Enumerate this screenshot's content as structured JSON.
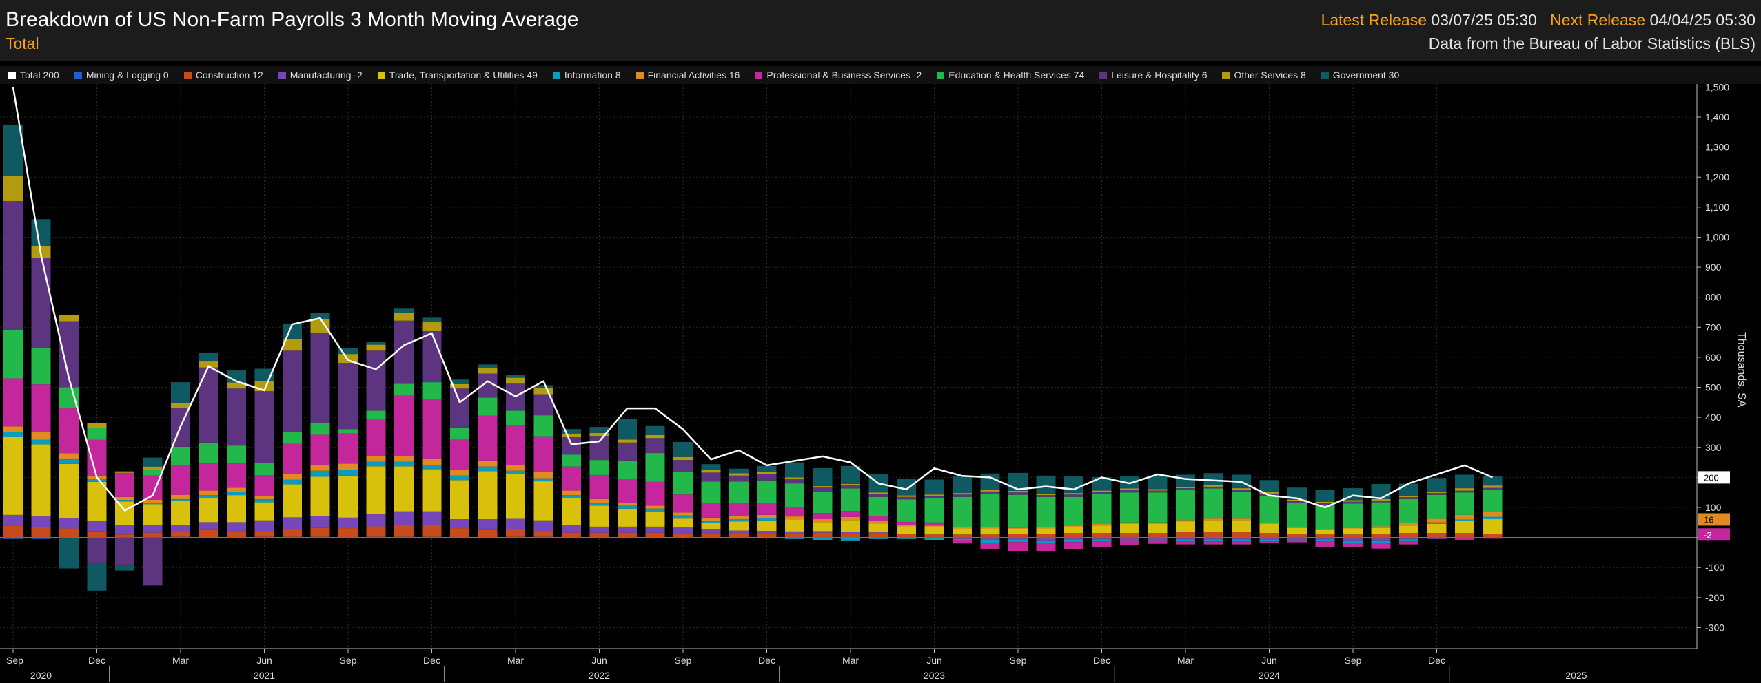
{
  "header": {
    "title": "Breakdown of US Non-Farm Payrolls 3 Month Moving Average",
    "subtitle": "Total",
    "latest_label": "Latest Release",
    "latest_value": "03/07/25 05:30",
    "next_label": "Next Release",
    "next_value": "04/04/25 05:30",
    "source": "Data from the Bureau of Labor Statistics (BLS)"
  },
  "chart_data": {
    "type": "bar",
    "title": "Breakdown of US Non-Farm Payrolls 3 Month Moving Average",
    "ylabel": "Thousands, SA",
    "ylim": [
      -370,
      1510
    ],
    "y_ticks": [
      -300,
      -200,
      -100,
      0,
      100,
      200,
      300,
      400,
      500,
      600,
      700,
      800,
      900,
      1000,
      1100,
      1200,
      1300,
      1400,
      1500
    ],
    "grid": true,
    "legend_placement": "top",
    "x_ticks": [
      {
        "i": 0,
        "label": "Sep"
      },
      {
        "i": 3,
        "label": "Dec"
      },
      {
        "i": 6,
        "label": "Mar"
      },
      {
        "i": 9,
        "label": "Jun"
      },
      {
        "i": 12,
        "label": "Sep"
      },
      {
        "i": 15,
        "label": "Dec"
      },
      {
        "i": 18,
        "label": "Mar"
      },
      {
        "i": 21,
        "label": "Jun"
      },
      {
        "i": 24,
        "label": "Sep"
      },
      {
        "i": 27,
        "label": "Dec"
      },
      {
        "i": 30,
        "label": "Mar"
      },
      {
        "i": 33,
        "label": "Jun"
      },
      {
        "i": 36,
        "label": "Sep"
      },
      {
        "i": 39,
        "label": "Dec"
      },
      {
        "i": 42,
        "label": "Mar"
      },
      {
        "i": 45,
        "label": "Jun"
      },
      {
        "i": 48,
        "label": "Sep"
      },
      {
        "i": 51,
        "label": "Dec"
      }
    ],
    "year_labels": [
      {
        "i": 1.0,
        "label": "2020"
      },
      {
        "i": 9.0,
        "label": "2021"
      },
      {
        "i": 21.0,
        "label": "2022"
      },
      {
        "i": 33.0,
        "label": "2023"
      },
      {
        "i": 45.0,
        "label": "2024"
      },
      {
        "i": 56.0,
        "label": "2025"
      }
    ],
    "year_boundaries": [
      4,
      16,
      28,
      40,
      52
    ],
    "categories": [
      "Sep 2020",
      "Oct 2020",
      "Nov 2020",
      "Dec 2020",
      "Jan 2021",
      "Feb 2021",
      "Mar 2021",
      "Apr 2021",
      "May 2021",
      "Jun 2021",
      "Jul 2021",
      "Aug 2021",
      "Sep 2021",
      "Oct 2021",
      "Nov 2021",
      "Dec 2021",
      "Jan 2022",
      "Feb 2022",
      "Mar 2022",
      "Apr 2022",
      "May 2022",
      "Jun 2022",
      "Jul 2022",
      "Aug 2022",
      "Sep 2022",
      "Oct 2022",
      "Nov 2022",
      "Dec 2022",
      "Jan 2023",
      "Feb 2023",
      "Mar 2023",
      "Apr 2023",
      "May 2023",
      "Jun 2023",
      "Jul 2023",
      "Aug 2023",
      "Sep 2023",
      "Oct 2023",
      "Nov 2023",
      "Dec 2023",
      "Jan 2024",
      "Feb 2024",
      "Mar 2024",
      "Apr 2024",
      "May 2024",
      "Jun 2024",
      "Jul 2024",
      "Aug 2024",
      "Sep 2024",
      "Oct 2024",
      "Nov 2024",
      "Dec 2024",
      "Jan 2025",
      "Feb 2025"
    ],
    "series": [
      {
        "name": "Total",
        "latest": 200,
        "color": "#ffffff",
        "type": "line",
        "values": [
          1500,
          940,
          530,
          200,
          90,
          140,
          370,
          570,
          520,
          490,
          710,
          730,
          590,
          560,
          640,
          680,
          450,
          520,
          470,
          520,
          310,
          320,
          430,
          430,
          360,
          260,
          290,
          240,
          255,
          270,
          250,
          180,
          160,
          230,
          205,
          200,
          160,
          170,
          160,
          200,
          180,
          210,
          195,
          190,
          185,
          140,
          130,
          100,
          140,
          130,
          180,
          210,
          240,
          200
        ]
      },
      {
        "name": "Mining & Logging",
        "latest": 0,
        "color": "#1f5fd0",
        "values": [
          -5,
          -5,
          -3,
          -2,
          0,
          1,
          2,
          1,
          1,
          2,
          2,
          2,
          1,
          2,
          2,
          2,
          1,
          1,
          2,
          2,
          1,
          1,
          1,
          1,
          1,
          1,
          1,
          0,
          0,
          1,
          0,
          0,
          0,
          0,
          0,
          0,
          0,
          0,
          0,
          0,
          0,
          0,
          0,
          0,
          0,
          0,
          0,
          0,
          0,
          0,
          0,
          0,
          0,
          0
        ]
      },
      {
        "name": "Construction",
        "latest": 12,
        "color": "#c84b1c",
        "values": [
          40,
          35,
          30,
          20,
          10,
          15,
          20,
          25,
          20,
          20,
          25,
          30,
          30,
          35,
          40,
          40,
          30,
          25,
          25,
          20,
          15,
          15,
          15,
          15,
          12,
          12,
          10,
          12,
          15,
          15,
          15,
          15,
          12,
          10,
          10,
          10,
          12,
          12,
          15,
          15,
          15,
          15,
          18,
          18,
          18,
          15,
          12,
          10,
          10,
          12,
          15,
          15,
          15,
          12
        ]
      },
      {
        "name": "Manufacturing",
        "latest": -2,
        "color": "#7547b8",
        "values": [
          35,
          35,
          35,
          35,
          30,
          25,
          20,
          25,
          30,
          35,
          40,
          40,
          35,
          40,
          45,
          45,
          30,
          35,
          35,
          35,
          25,
          20,
          20,
          20,
          20,
          15,
          12,
          10,
          5,
          5,
          3,
          2,
          0,
          -3,
          -5,
          -8,
          -10,
          -12,
          -10,
          -8,
          -8,
          -8,
          -10,
          -10,
          -10,
          -8,
          -8,
          -10,
          -12,
          -12,
          -10,
          -5,
          -3,
          -2
        ]
      },
      {
        "name": "Trade, Transportation & Utilities",
        "latest": 49,
        "color": "#d8c00b",
        "values": [
          260,
          240,
          180,
          130,
          80,
          70,
          80,
          80,
          90,
          60,
          110,
          130,
          140,
          160,
          150,
          140,
          130,
          160,
          150,
          130,
          90,
          70,
          60,
          50,
          30,
          20,
          30,
          35,
          40,
          30,
          40,
          30,
          25,
          25,
          20,
          20,
          15,
          18,
          20,
          25,
          30,
          30,
          35,
          40,
          40,
          30,
          20,
          15,
          20,
          20,
          25,
          30,
          40,
          49
        ]
      },
      {
        "name": "Information",
        "latest": 8,
        "color": "#0a9cc0",
        "values": [
          15,
          15,
          15,
          10,
          5,
          5,
          5,
          10,
          10,
          10,
          15,
          20,
          20,
          15,
          15,
          15,
          15,
          15,
          10,
          10,
          10,
          10,
          10,
          10,
          10,
          8,
          8,
          8,
          -5,
          -10,
          -12,
          -5,
          -5,
          -5,
          -5,
          -10,
          -5,
          -5,
          -5,
          -5,
          -3,
          -3,
          -3,
          -3,
          -3,
          -5,
          -3,
          -3,
          -5,
          -5,
          -3,
          5,
          5,
          8
        ]
      },
      {
        "name": "Financial Activities",
        "latest": 16,
        "color": "#e08a1f",
        "values": [
          20,
          25,
          20,
          10,
          10,
          10,
          15,
          15,
          15,
          10,
          20,
          20,
          20,
          20,
          20,
          20,
          20,
          20,
          20,
          20,
          15,
          12,
          10,
          10,
          10,
          10,
          10,
          10,
          10,
          10,
          10,
          8,
          5,
          5,
          5,
          5,
          5,
          5,
          5,
          5,
          5,
          5,
          5,
          5,
          5,
          3,
          3,
          3,
          3,
          5,
          8,
          12,
          15,
          16
        ]
      },
      {
        "name": "Professional & Business Services",
        "latest": -2,
        "color": "#c4279b",
        "values": [
          160,
          160,
          150,
          120,
          80,
          80,
          100,
          90,
          80,
          70,
          100,
          100,
          100,
          120,
          200,
          200,
          100,
          150,
          130,
          120,
          80,
          80,
          80,
          80,
          60,
          50,
          45,
          40,
          30,
          20,
          20,
          15,
          10,
          10,
          -10,
          -20,
          -30,
          -30,
          -25,
          -20,
          -15,
          -10,
          -10,
          -10,
          -10,
          -5,
          -5,
          -20,
          -15,
          -20,
          -10,
          0,
          -5,
          -2
        ]
      },
      {
        "name": "Education & Health Services",
        "latest": 74,
        "color": "#22b84a",
        "values": [
          160,
          120,
          70,
          40,
          0,
          20,
          60,
          70,
          60,
          40,
          40,
          40,
          15,
          30,
          40,
          55,
          40,
          60,
          50,
          70,
          40,
          50,
          60,
          95,
          75,
          70,
          70,
          75,
          80,
          70,
          75,
          65,
          75,
          80,
          100,
          110,
          110,
          100,
          95,
          100,
          100,
          100,
          100,
          100,
          90,
          90,
          80,
          80,
          80,
          80,
          80,
          80,
          75,
          74
        ]
      },
      {
        "name": "Leisure & Hospitality",
        "latest": 6,
        "color": "#5c3480",
        "values": [
          430,
          300,
          220,
          -85,
          -90,
          -160,
          130,
          250,
          190,
          240,
          270,
          300,
          220,
          200,
          210,
          170,
          130,
          80,
          90,
          70,
          60,
          80,
          60,
          50,
          40,
          30,
          20,
          20,
          15,
          15,
          10,
          10,
          8,
          8,
          8,
          8,
          8,
          6,
          8,
          6,
          8,
          6,
          6,
          6,
          6,
          8,
          6,
          6,
          6,
          6,
          6,
          6,
          6,
          6
        ]
      },
      {
        "name": "Other Services",
        "latest": 8,
        "color": "#b39b10",
        "values": [
          85,
          40,
          20,
          15,
          5,
          10,
          15,
          20,
          20,
          35,
          40,
          45,
          30,
          20,
          25,
          30,
          15,
          20,
          20,
          20,
          10,
          10,
          10,
          10,
          10,
          8,
          8,
          8,
          5,
          5,
          5,
          5,
          5,
          5,
          5,
          5,
          5,
          5,
          5,
          5,
          5,
          5,
          5,
          5,
          5,
          5,
          5,
          5,
          5,
          5,
          5,
          5,
          8,
          8
        ]
      },
      {
        "name": "Government",
        "latest": 30,
        "color": "#0f5963",
        "values": [
          170,
          90,
          -100,
          -90,
          -20,
          30,
          70,
          30,
          40,
          40,
          50,
          20,
          20,
          10,
          15,
          15,
          15,
          10,
          10,
          10,
          15,
          20,
          70,
          30,
          50,
          20,
          15,
          20,
          50,
          60,
          60,
          60,
          55,
          50,
          55,
          55,
          60,
          60,
          55,
          45,
          40,
          45,
          40,
          40,
          45,
          40,
          40,
          40,
          40,
          50,
          40,
          45,
          45,
          30
        ]
      }
    ],
    "value_tags": [
      {
        "label": "200",
        "color": "#ffffff",
        "text_color": "#000000"
      },
      {
        "label": "16",
        "color": "#e08a1f",
        "text_color": "#000000"
      },
      {
        "label": "-2",
        "color": "#c4279b",
        "text_color": "#ffffff"
      }
    ]
  }
}
